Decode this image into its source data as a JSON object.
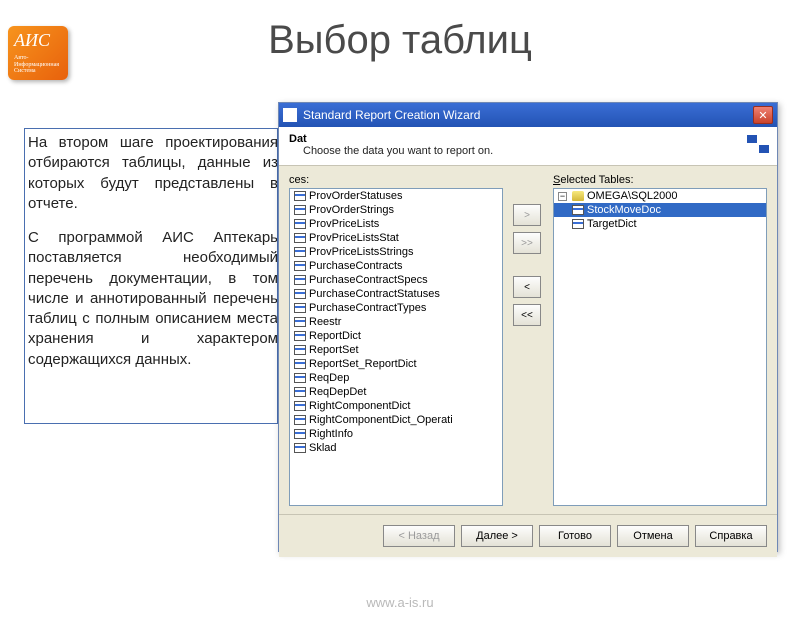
{
  "logo": {
    "text": "АИС",
    "sub": "Авто-\nИнформационная\nСистема"
  },
  "title": "Выбор таблиц",
  "paragraphs": [
    "На втором шаге проектирования отбираются таблицы, данные из которых будут представлены в отчете.",
    "С программой АИС Аптекарь поставляется необходимый перечень документации, в том числе и аннотированный перечень таблиц с полным описанием места хранения и характером содержащихся данных."
  ],
  "footer": "www.a-is.ru",
  "dialog": {
    "title": "Standard Report Creation Wizard",
    "header_title": "Dat",
    "header_desc": "Choose the data you want to report on.",
    "available_label": "ces:",
    "selected_label": "Selected Tables:",
    "available_items": [
      "ProvOrderStatuses",
      "ProvOrderStrings",
      "ProvPriceLists",
      "ProvPriceListsStat",
      "ProvPriceListsStrings",
      "PurchaseContracts",
      "PurchaseContractSpecs",
      "PurchaseContractStatuses",
      "PurchaseContractTypes",
      "Reestr",
      "ReportDict",
      "ReportSet",
      "ReportSet_ReportDict",
      "ReqDep",
      "ReqDepDet",
      "RightComponentDict",
      "RightComponentDict_Operati",
      "RightInfo",
      "Sklad"
    ],
    "selected_root": "OMEGA\\SQL2000",
    "selected_items": [
      "StockMoveDoc",
      "TargetDict"
    ],
    "buttons": {
      "add": ">",
      "add_all": ">>",
      "remove": "<",
      "remove_all": "<<",
      "back": "< Назад",
      "next": "Далее >",
      "finish": "Готово",
      "cancel": "Отмена",
      "help": "Справка"
    }
  }
}
